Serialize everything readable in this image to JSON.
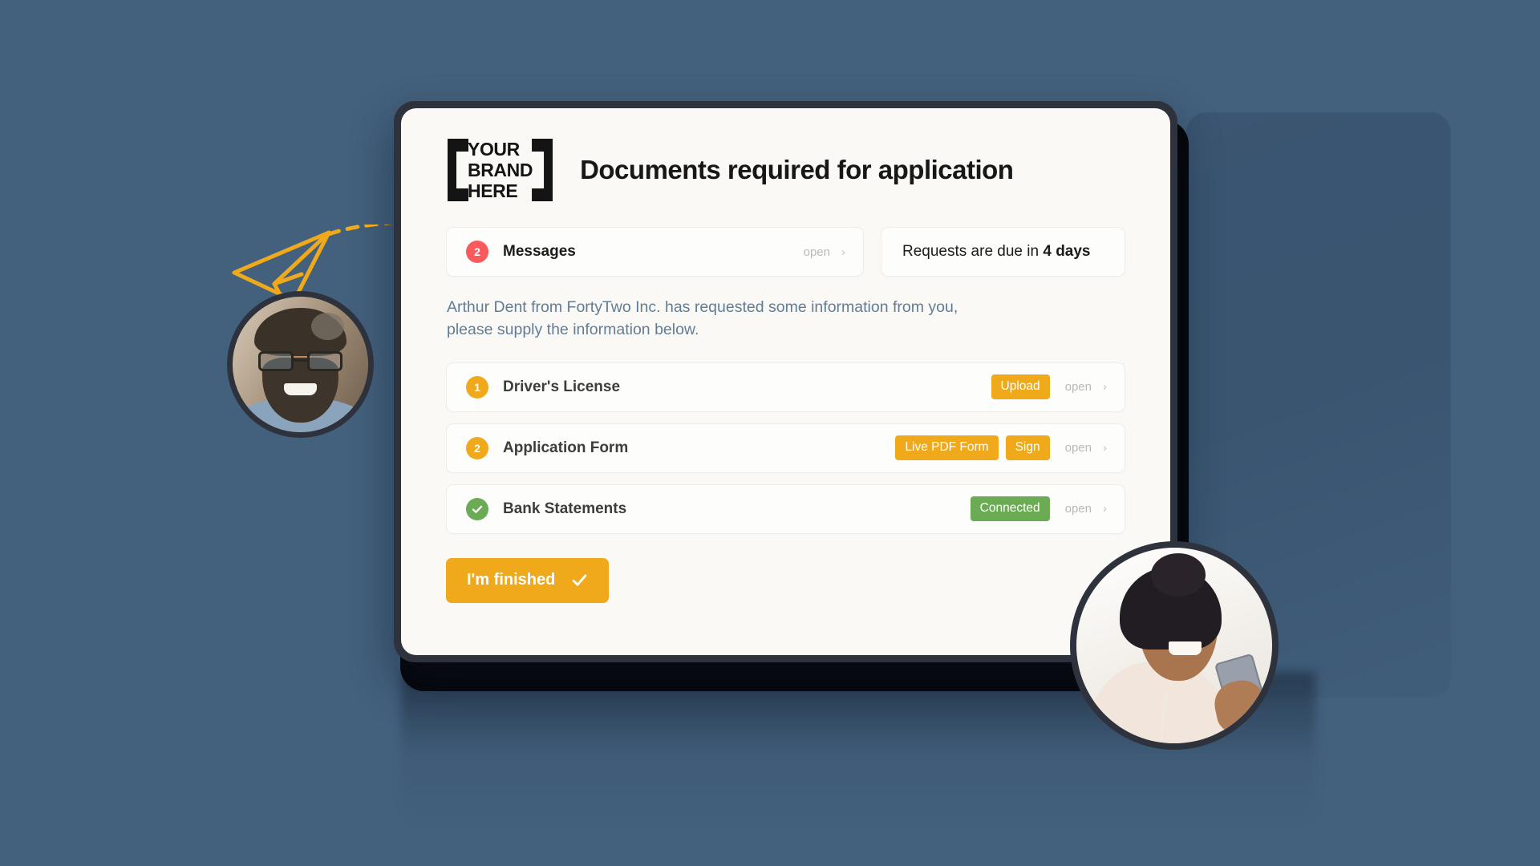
{
  "brand": {
    "logo_lines": [
      "YOUR",
      "BRAND",
      "HERE"
    ],
    "logo_name": "your-brand-here-logo"
  },
  "header": {
    "title": "Documents required for application"
  },
  "summary": {
    "messages": {
      "count": "2",
      "label": "Messages",
      "open_label": "open",
      "chevron": "›"
    },
    "due": {
      "prefix": "Requests are due in ",
      "highlight": "4 days",
      "suffix": ""
    }
  },
  "intro": {
    "text": "Arthur Dent from FortyTwo Inc. has requested some information from you, please supply the information below."
  },
  "documents": {
    "open_label": "open",
    "chevron": "›",
    "rows": [
      {
        "marker": "1",
        "marker_type": "number",
        "name": "Driver's License",
        "actions": [
          {
            "label": "Upload",
            "style": "yellow"
          }
        ]
      },
      {
        "marker": "2",
        "marker_type": "number",
        "name": "Application Form",
        "actions": [
          {
            "label": "Live PDF Form",
            "style": "yellow"
          },
          {
            "label": "Sign",
            "style": "yellow"
          }
        ]
      },
      {
        "marker": "✓",
        "marker_type": "check",
        "name": "Bank Statements",
        "actions": [
          {
            "label": "Connected",
            "style": "green"
          }
        ]
      }
    ]
  },
  "footer": {
    "finish_label": "I'm finished"
  },
  "colors": {
    "background": "#41607f",
    "accent_yellow": "#efa91a",
    "accent_red": "#fa5a5b",
    "accent_green": "#6aab53",
    "screen": "#faf9f6",
    "device_frame": "#2e323c",
    "muted_text": "#617d95"
  },
  "decor": {
    "paper_plane": "paper-plane-icon",
    "avatar_left": "avatar-man",
    "avatar_right": "avatar-woman"
  }
}
